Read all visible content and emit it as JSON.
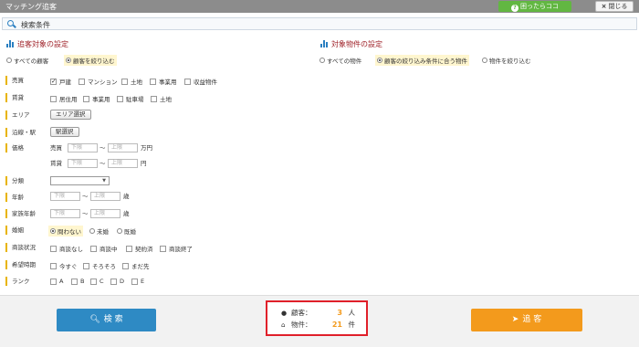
{
  "window": {
    "title": "マッチング追客",
    "help_label": "困ったらココ",
    "close_label": "閉じる"
  },
  "search_conditions": {
    "label": "検索条件"
  },
  "client_section": {
    "title": "追客対象の設定",
    "options": [
      "すべての顧客",
      "顧客を絞り込む"
    ],
    "selected": 1
  },
  "property_section": {
    "title": "対象物件の設定",
    "options": [
      "すべての物件",
      "顧客の絞り込み条件に合う物件",
      "物件を絞り込む"
    ],
    "selected": 1
  },
  "fields": {
    "sale": {
      "label": "売買",
      "options": [
        "戸建",
        "マンション",
        "土地",
        "事業用",
        "収益物件"
      ],
      "checked": [
        true,
        false,
        false,
        false,
        false
      ]
    },
    "rent": {
      "label": "賃貸",
      "options": [
        "居住用",
        "事業用",
        "駐車場",
        "土地"
      ]
    },
    "area": {
      "label": "エリア",
      "button": "エリア選択"
    },
    "route": {
      "label": "沿線・駅",
      "button": "駅選択"
    },
    "price": {
      "label": "価格",
      "sale_label": "売買",
      "sale_unit": "万円",
      "rent_label": "賃貸",
      "rent_unit": "円",
      "lower_placeholder": "下限",
      "upper_placeholder": "上限",
      "tilde": "〜"
    },
    "category": {
      "label": "分類",
      "value": ""
    },
    "age": {
      "label": "年齢",
      "unit": "歳",
      "lower_placeholder": "下限",
      "upper_placeholder": "上限",
      "tilde": "〜"
    },
    "family_age": {
      "label": "家族年齢",
      "unit": "歳",
      "lower_placeholder": "下限",
      "upper_placeholder": "上限",
      "tilde": "〜"
    },
    "marital": {
      "label": "婚姻",
      "options": [
        "問わない",
        "未婚",
        "既婚"
      ],
      "selected": 0
    },
    "contract": {
      "label": "商談状況",
      "options": [
        "商談なし",
        "商談中",
        "契約済",
        "商談終了"
      ]
    },
    "timing": {
      "label": "希望時期",
      "options": [
        "今すぐ",
        "そろそろ",
        "まだ先"
      ]
    },
    "rank": {
      "label": "ランク",
      "options": [
        "A",
        "B",
        "C",
        "D",
        "E"
      ]
    }
  },
  "footer": {
    "search_label": "検 索",
    "add_label": "追 客",
    "customers_label": "顧客：",
    "customers_count": "3",
    "customers_unit": "人",
    "properties_label": "物件：",
    "properties_count": "21",
    "properties_unit": "件"
  },
  "colors": {
    "accent_blue": "#2e8ac4",
    "accent_orange": "#f39a1c",
    "section_red": "#a0252c",
    "help_green": "#62b742",
    "highlight_red": "#e0202a"
  }
}
